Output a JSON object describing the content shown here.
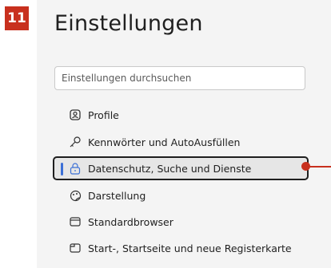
{
  "step": {
    "number": "11"
  },
  "settings": {
    "title": "Einstellungen",
    "search_placeholder": "Einstellungen durchsuchen",
    "nav": [
      {
        "label": "Profile",
        "icon": "profile-icon"
      },
      {
        "label": "Kennwörter und AutoAusfüllen",
        "icon": "key-icon"
      },
      {
        "label": "Datenschutz, Suche und Dienste",
        "icon": "lock-icon",
        "selected": true
      },
      {
        "label": "Darstellung",
        "icon": "appearance-icon"
      },
      {
        "label": "Standardbrowser",
        "icon": "browser-icon"
      },
      {
        "label": "Start-, Startseite und neue Registerkarte",
        "icon": "tab-icon"
      }
    ]
  },
  "colors": {
    "accent": "#3b6fd6",
    "callout": "#c8301e",
    "panel": "#f4f4f4"
  }
}
